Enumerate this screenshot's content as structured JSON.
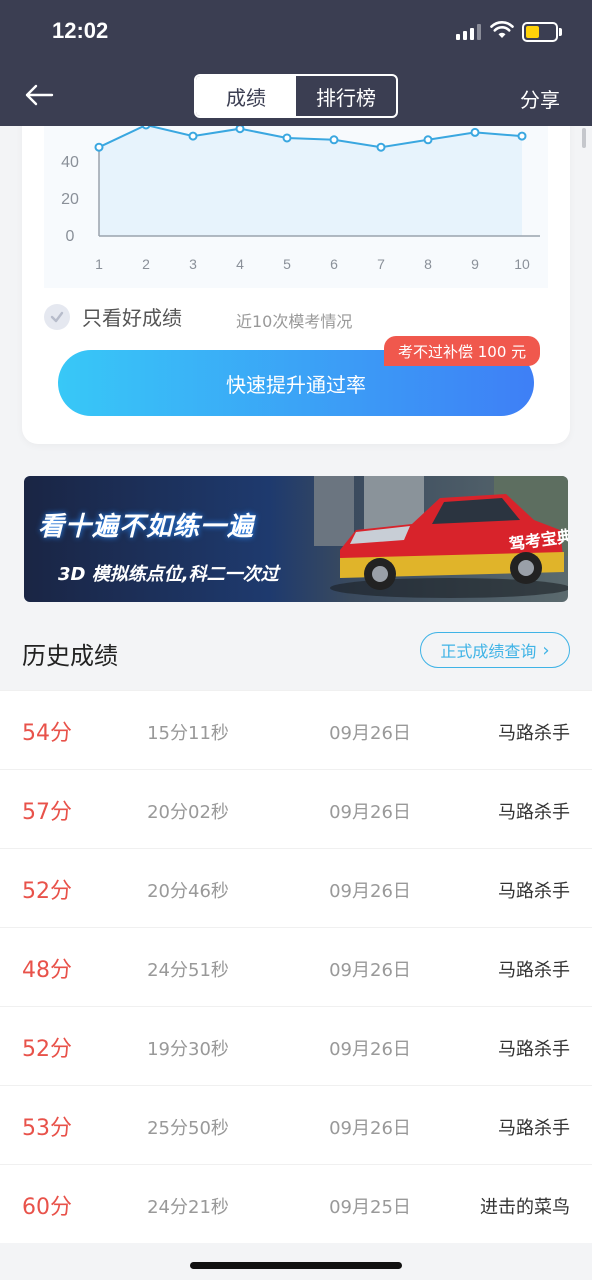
{
  "status": {
    "time": "12:02"
  },
  "nav": {
    "tabs": [
      "成绩",
      "排行榜"
    ],
    "active_tab": "成绩",
    "share": "分享"
  },
  "chart_data": {
    "type": "line",
    "x": [
      1,
      2,
      3,
      4,
      5,
      6,
      7,
      8,
      9,
      10
    ],
    "values": [
      48,
      60,
      54,
      58,
      53,
      52,
      48,
      52,
      56,
      54
    ],
    "y_ticks": [
      "0",
      "20",
      "40"
    ],
    "x_ticks": [
      "1",
      "2",
      "3",
      "4",
      "5",
      "6",
      "7",
      "8",
      "9",
      "10"
    ],
    "ylim": [
      0,
      100
    ],
    "colors": {
      "line": "#3aa7e0",
      "area": "#e7f3fc"
    }
  },
  "card": {
    "good_only": "只看好成绩",
    "recent": "近10次模考情况",
    "boost_button": "快速提升通过率",
    "badge": "考不过补偿 100 元"
  },
  "banner": {
    "title": "看十遍不如练一遍",
    "subtitle": "3D 模拟练点位,科二一次过",
    "car_text": "驾考宝典"
  },
  "history": {
    "title": "历史成绩",
    "official_query": "正式成绩查询",
    "rows": [
      {
        "score": "54分",
        "duration": "15分11秒",
        "date": "09月26日",
        "title": "马路杀手"
      },
      {
        "score": "57分",
        "duration": "20分02秒",
        "date": "09月26日",
        "title": "马路杀手"
      },
      {
        "score": "52分",
        "duration": "20分46秒",
        "date": "09月26日",
        "title": "马路杀手"
      },
      {
        "score": "48分",
        "duration": "24分51秒",
        "date": "09月26日",
        "title": "马路杀手"
      },
      {
        "score": "52分",
        "duration": "19分30秒",
        "date": "09月26日",
        "title": "马路杀手"
      },
      {
        "score": "53分",
        "duration": "25分50秒",
        "date": "09月26日",
        "title": "马路杀手"
      },
      {
        "score": "60分",
        "duration": "24分21秒",
        "date": "09月25日",
        "title": "进击的菜鸟"
      }
    ]
  }
}
